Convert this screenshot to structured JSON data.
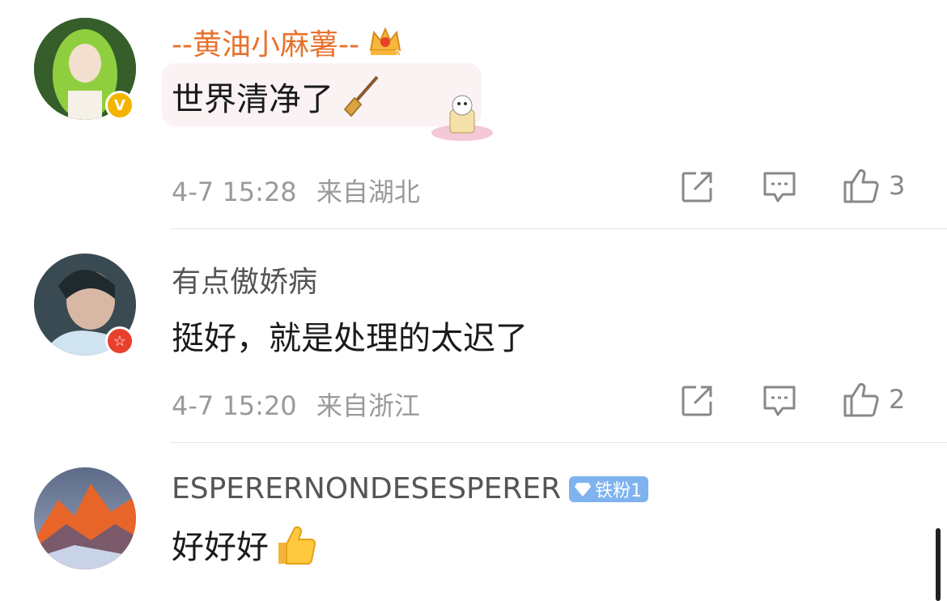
{
  "comments": [
    {
      "username": "--黄油小麻薯--",
      "text": "世界清净了",
      "timestamp": "4-7 15:28",
      "location": "来自湖北",
      "likes": "3",
      "badge": "V",
      "username_color": "#e8722d"
    },
    {
      "username": "有点傲娇病",
      "text": "挺好，就是处理的太迟了",
      "timestamp": "4-7 15:20",
      "location": "来自浙江",
      "likes": "2",
      "badge": "☆"
    },
    {
      "username": "ESPERERNONDESESPERER",
      "fan_badge": "铁粉1",
      "text": "好好好"
    }
  ],
  "icons": {
    "share": "share-icon",
    "comment": "comment-icon",
    "like": "thumbs-up-icon",
    "crown": "crown-icon",
    "broom": "broom-icon",
    "thumb_emoji": "thumbs-up-emoji-icon",
    "diamond": "diamond-icon"
  },
  "colors": {
    "username_vip": "#e8722d",
    "text": "#1a1a1a",
    "meta": "#9a9a9a",
    "verified_badge": "#f4b400",
    "red_badge": "#e8402c",
    "fan_badge": "#7fb3f0"
  }
}
